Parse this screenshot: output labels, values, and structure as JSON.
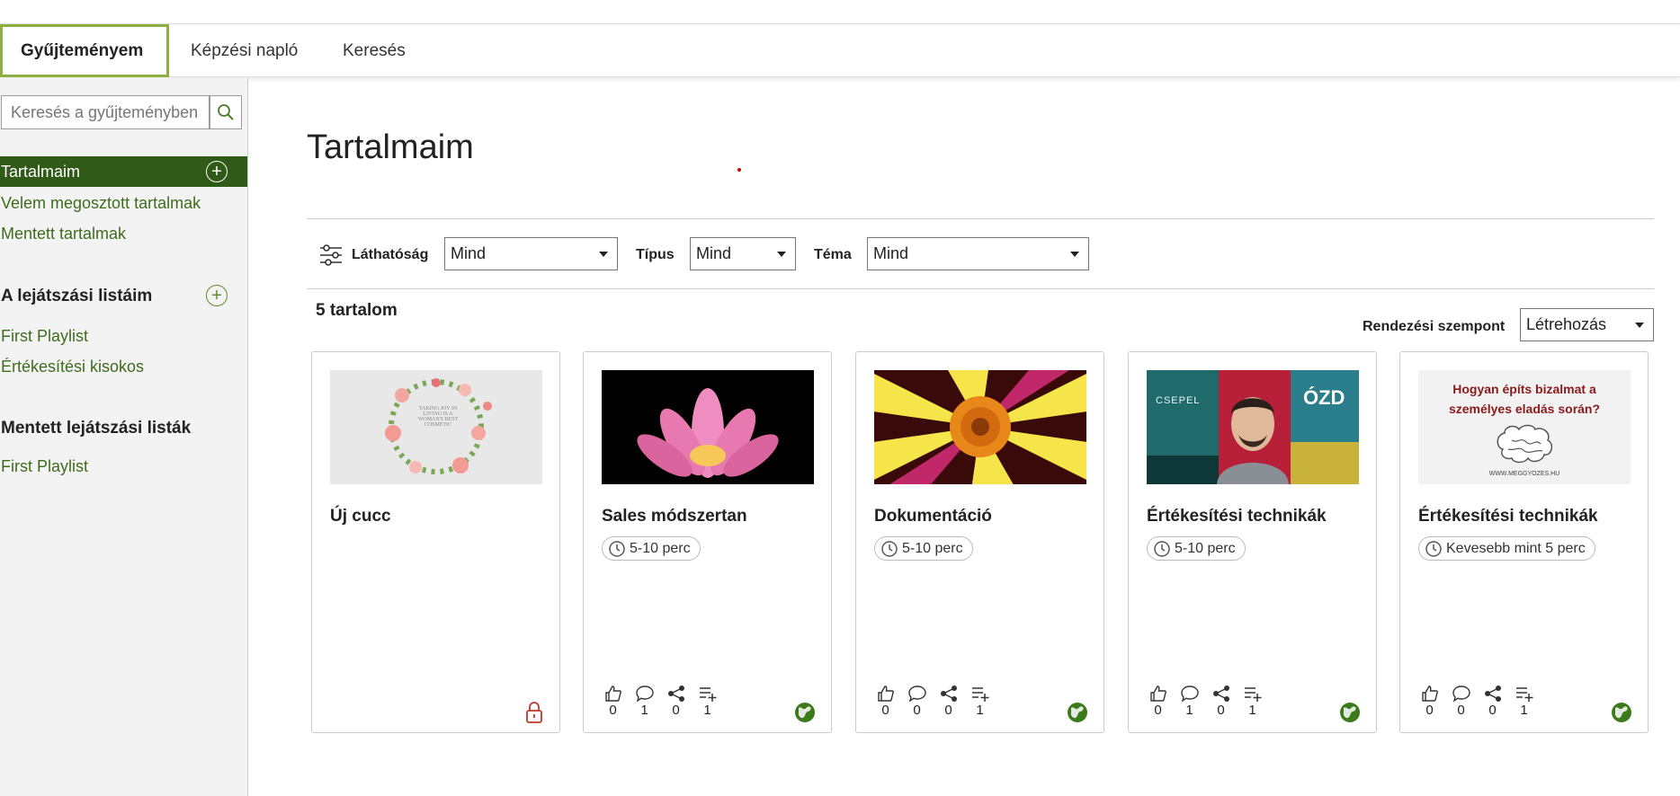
{
  "tabs": [
    {
      "label": "Gyűjteményem",
      "active": true
    },
    {
      "label": "Képzési napló",
      "active": false
    },
    {
      "label": "Keresés",
      "active": false
    }
  ],
  "sidebar": {
    "search_placeholder": "Keresés a gyűjteményben",
    "items": [
      {
        "label": "Tartalmaim",
        "active": true
      },
      {
        "label": "Velem megosztott tartalmak"
      },
      {
        "label": "Mentett tartalmak"
      }
    ],
    "playlists_heading": "A lejátszási listáim",
    "playlists": [
      "First Playlist",
      "Értékesítési kisokos"
    ],
    "saved_playlists_heading": "Mentett lejátszási listák",
    "saved_playlists": [
      "First Playlist"
    ]
  },
  "main": {
    "title": "Tartalmaim",
    "filters": {
      "visibility_label": "Láthatóság",
      "visibility_value": "Mind",
      "type_label": "Típus",
      "type_value": "Mind",
      "topic_label": "Téma",
      "topic_value": "Mind"
    },
    "count": "5 tartalom",
    "sort_label": "Rendezési szempont",
    "sort_value": "Létrehozás",
    "cards": [
      {
        "title": "Új cucc",
        "duration": "",
        "likes": "",
        "comments": "",
        "shares": "",
        "adds": "",
        "status_icon": "lock-icon"
      },
      {
        "title": "Sales módszertan",
        "duration": "5-10 perc",
        "likes": "0",
        "comments": "1",
        "shares": "0",
        "adds": "1",
        "status_icon": "globe-icon"
      },
      {
        "title": "Dokumentáció",
        "duration": "5-10 perc",
        "likes": "0",
        "comments": "0",
        "shares": "0",
        "adds": "1",
        "status_icon": "globe-icon"
      },
      {
        "title": "Értékesítési technikák",
        "duration": "5-10 perc",
        "likes": "0",
        "comments": "1",
        "shares": "0",
        "adds": "1",
        "status_icon": "globe-icon"
      },
      {
        "title": "Értékesítési technikák",
        "duration": "Kevesebb mint 5 perc",
        "likes": "0",
        "comments": "0",
        "shares": "0",
        "adds": "1",
        "status_icon": "globe-icon"
      }
    ],
    "thumb_texts": {
      "card1_quote": "TAKING JOY IN LIVING IS A WOMAN'S BEST COSMETIC",
      "card4_left": "CSEPEL",
      "card4_right": "ÓZD",
      "card5_question": "Hogyan építs bizalmat a személyes eladás során?",
      "card5_url": "WWW.MEGGYOZES.HU"
    }
  },
  "colors": {
    "accent": "#8db040",
    "sidebar_active": "#2f5a17",
    "link": "#3d6d1c",
    "lock": "#c0392b",
    "globe": "#3d7a1c"
  }
}
